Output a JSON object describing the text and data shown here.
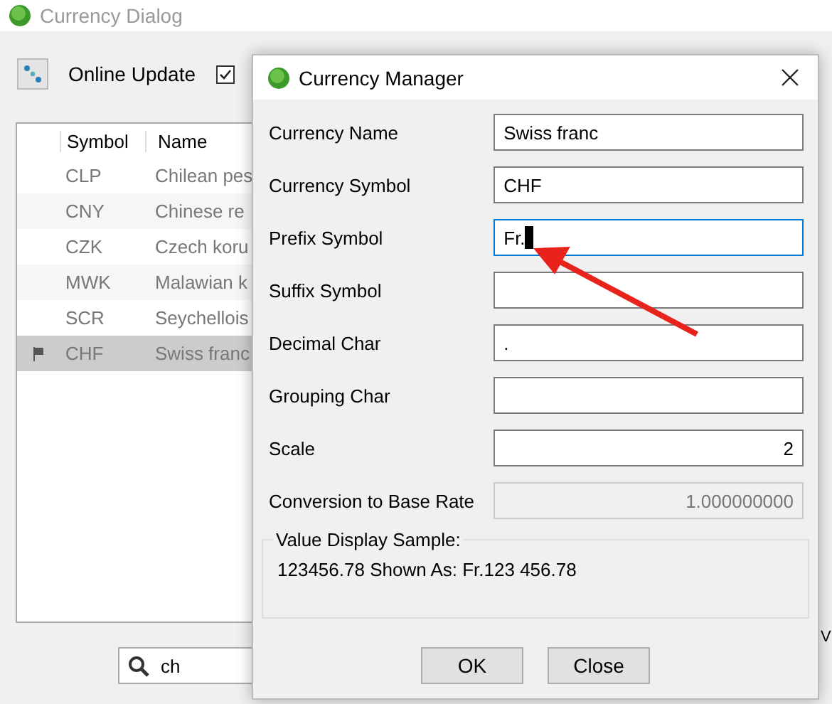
{
  "window": {
    "title": "Currency Dialog"
  },
  "toolbar": {
    "online_update": "Online Update",
    "checkbox": {
      "checked": true
    }
  },
  "table": {
    "columns": [
      "Symbol",
      "Name"
    ],
    "rows": [
      {
        "symbol": "CLP",
        "name": "Chilean pes",
        "selected": false,
        "flagged": false
      },
      {
        "symbol": "CNY",
        "name": "Chinese re",
        "selected": false,
        "flagged": false
      },
      {
        "symbol": "CZK",
        "name": "Czech koru",
        "selected": false,
        "flagged": false
      },
      {
        "symbol": "MWK",
        "name": "Malawian k",
        "selected": false,
        "flagged": false
      },
      {
        "symbol": "SCR",
        "name": "Seychellois",
        "selected": false,
        "flagged": false
      },
      {
        "symbol": "CHF",
        "name": "Swiss franc",
        "selected": true,
        "flagged": true
      }
    ]
  },
  "search": {
    "value": "ch"
  },
  "edge_label": "V",
  "dialog": {
    "title": "Currency Manager",
    "fields": [
      {
        "label": "Currency Name",
        "value": "Swiss franc",
        "kind": "text",
        "focused": false
      },
      {
        "label": "Currency Symbol",
        "value": "CHF",
        "kind": "text",
        "focused": false
      },
      {
        "label": "Prefix Symbol",
        "value": "Fr.",
        "kind": "text",
        "focused": true
      },
      {
        "label": "Suffix Symbol",
        "kind": "text",
        "focused": false
      },
      {
        "label": "Decimal Char",
        "value": ".",
        "kind": "text",
        "focused": false
      },
      {
        "label": "Grouping Char",
        "kind": "text",
        "focused": false
      },
      {
        "label": "Scale",
        "value": "2",
        "kind": "number",
        "focused": false
      },
      {
        "label": "Conversion to Base Rate",
        "value": "1.000000000",
        "kind": "disabled",
        "focused": false
      }
    ],
    "sample": {
      "legend": "Value Display Sample:",
      "text": "123456.78 Shown As: Fr.123 456.78"
    },
    "buttons": [
      "OK",
      "Close"
    ]
  }
}
